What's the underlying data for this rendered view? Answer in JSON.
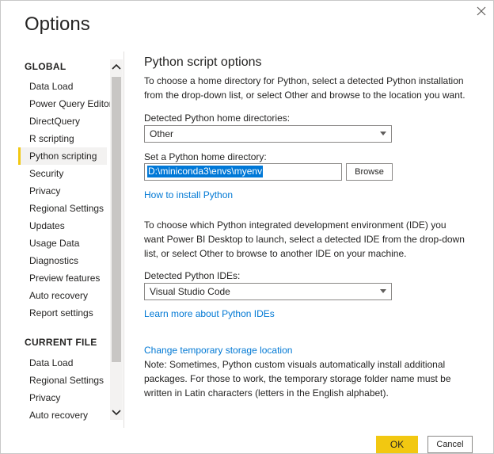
{
  "dialog": {
    "title": "Options"
  },
  "sidebar": {
    "global_heading": "GLOBAL",
    "global_items": [
      {
        "label": "Data Load"
      },
      {
        "label": "Power Query Editor"
      },
      {
        "label": "DirectQuery"
      },
      {
        "label": "R scripting"
      },
      {
        "label": "Python scripting"
      },
      {
        "label": "Security"
      },
      {
        "label": "Privacy"
      },
      {
        "label": "Regional Settings"
      },
      {
        "label": "Updates"
      },
      {
        "label": "Usage Data"
      },
      {
        "label": "Diagnostics"
      },
      {
        "label": "Preview features"
      },
      {
        "label": "Auto recovery"
      },
      {
        "label": "Report settings"
      }
    ],
    "selected_item": "Python scripting",
    "current_file_heading": "CURRENT FILE",
    "current_file_items": [
      {
        "label": "Data Load"
      },
      {
        "label": "Regional Settings"
      },
      {
        "label": "Privacy"
      },
      {
        "label": "Auto recovery"
      }
    ]
  },
  "main": {
    "heading": "Python script options",
    "intro": "To choose a home directory for Python, select a detected Python installation from the drop-down list, or select Other and browse to the location you want.",
    "home_dirs_label": "Detected Python home directories:",
    "home_dirs_value": "Other",
    "set_home_label": "Set a Python home directory:",
    "home_dir_value": "D:\\miniconda3\\envs\\myenv",
    "browse_label": "Browse",
    "install_link": "How to install Python",
    "ide_intro": "To choose which Python integrated development environment (IDE) you want Power BI Desktop to launch, select a detected IDE from the drop-down list, or select Other to browse to another IDE on your machine.",
    "ide_label": "Detected Python IDEs:",
    "ide_value": "Visual Studio Code",
    "ide_link": "Learn more about Python IDEs",
    "storage_link": "Change temporary storage location",
    "note": "Note: Sometimes, Python custom visuals automatically install additional packages. For those to work, the temporary storage folder name must be written in Latin characters (letters in the English alphabet)."
  },
  "footer": {
    "ok_label": "OK",
    "cancel_label": "Cancel"
  },
  "colors": {
    "accent": "#f2c811",
    "link": "#0078d4",
    "selection": "#0078d7"
  }
}
